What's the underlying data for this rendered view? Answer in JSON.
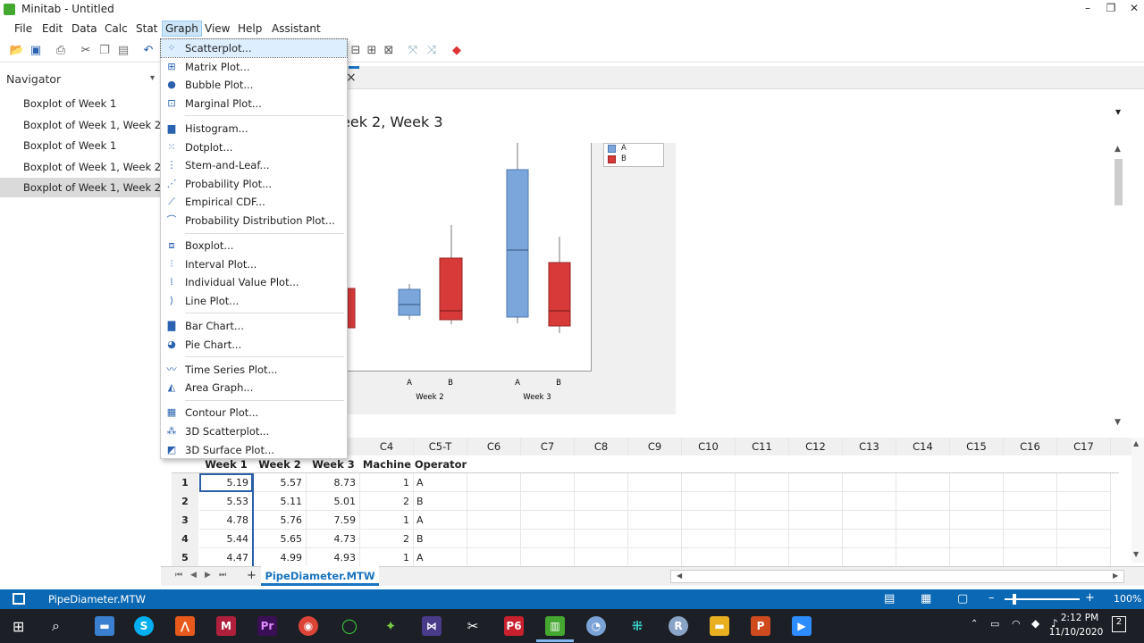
{
  "window": {
    "title": "Minitab - Untitled",
    "minimize": "–",
    "maximize": "❐",
    "close": "✕"
  },
  "menubar": [
    "File",
    "Edit",
    "Data",
    "Calc",
    "Stat",
    "Graph",
    "View",
    "Help",
    "Assistant"
  ],
  "navigator": {
    "header": "Navigator",
    "items": [
      "Boxplot of Week 1",
      "Boxplot of Week 1, Week 2, ...",
      "Boxplot of Week 1",
      "Boxplot of Week 1, Week 2, ...",
      "Boxplot of Week 1, Week 2, ..."
    ],
    "selected_index": 4
  },
  "output": {
    "close_glyph": "×",
    "graph_title_partial": "eek 2, Week 3",
    "dropdown_glyph": "▾"
  },
  "chart_data": {
    "type": "boxplot",
    "legend": [
      {
        "name": "A",
        "color": "#7aa6dc"
      },
      {
        "name": "B",
        "color": "#d83a3a"
      }
    ],
    "groups": [
      {
        "name": "Week 2",
        "categories": [
          "A",
          "B"
        ]
      },
      {
        "name": "Week 3",
        "categories": [
          "A",
          "B"
        ]
      }
    ],
    "colors": {
      "A": "#7aa6dc",
      "B": "#d83a3a"
    }
  },
  "graph_menu": {
    "items": [
      {
        "label": "Scatterplot...",
        "icon": "scatter-icon",
        "glyph": "⁘",
        "highlighted": true
      },
      {
        "label": "Matrix Plot...",
        "icon": "matrix-plot-icon",
        "glyph": "⊞"
      },
      {
        "label": "Bubble Plot...",
        "icon": "bubble-plot-icon",
        "glyph": "●"
      },
      {
        "label": "Marginal Plot...",
        "icon": "marginal-plot-icon",
        "glyph": "⊡"
      },
      {
        "sep": true
      },
      {
        "label": "Histogram...",
        "icon": "histogram-icon",
        "glyph": "▆"
      },
      {
        "label": "Dotplot...",
        "icon": "dotplot-icon",
        "glyph": "⁙"
      },
      {
        "label": "Stem-and-Leaf...",
        "icon": "stem-leaf-icon",
        "glyph": "⋮"
      },
      {
        "label": "Probability Plot...",
        "icon": "probability-plot-icon",
        "glyph": "⋰"
      },
      {
        "label": "Empirical CDF...",
        "icon": "empirical-cdf-icon",
        "glyph": "⟋"
      },
      {
        "label": "Probability Distribution Plot...",
        "icon": "distribution-plot-icon",
        "glyph": "⌒"
      },
      {
        "sep": true
      },
      {
        "label": "Boxplot...",
        "icon": "boxplot-icon",
        "glyph": "⧈"
      },
      {
        "label": "Interval Plot...",
        "icon": "interval-plot-icon",
        "glyph": "⫶"
      },
      {
        "label": "Individual Value Plot...",
        "icon": "individual-value-icon",
        "glyph": "⁞"
      },
      {
        "label": "Line Plot...",
        "icon": "line-plot-icon",
        "glyph": "⟩"
      },
      {
        "sep": true
      },
      {
        "label": "Bar Chart...",
        "icon": "bar-chart-icon",
        "glyph": "▇"
      },
      {
        "label": "Pie Chart...",
        "icon": "pie-chart-icon",
        "glyph": "◕"
      },
      {
        "sep": true
      },
      {
        "label": "Time Series Plot...",
        "icon": "time-series-icon",
        "glyph": "〰"
      },
      {
        "label": "Area Graph...",
        "icon": "area-graph-icon",
        "glyph": "◭"
      },
      {
        "sep": true
      },
      {
        "label": "Contour Plot...",
        "icon": "contour-plot-icon",
        "glyph": "▦"
      },
      {
        "label": "3D Scatterplot...",
        "icon": "3d-scatter-icon",
        "glyph": "⁂"
      },
      {
        "label": "3D Surface Plot...",
        "icon": "3d-surface-icon",
        "glyph": "◩"
      }
    ]
  },
  "worksheet": {
    "column_ids": [
      "C4",
      "C5-T",
      "C6",
      "C7",
      "C8",
      "C9",
      "C10",
      "C11",
      "C12",
      "C13",
      "C14",
      "C15",
      "C16",
      "C17"
    ],
    "variable_names": [
      "Week 1",
      "Week 2",
      "Week 3",
      "Machine",
      "Operator"
    ],
    "rows": [
      {
        "n": "1",
        "cells": [
          "5.19",
          "5.57",
          "8.73",
          "1",
          "A"
        ]
      },
      {
        "n": "2",
        "cells": [
          "5.53",
          "5.11",
          "5.01",
          "2",
          "B"
        ]
      },
      {
        "n": "3",
        "cells": [
          "4.78",
          "5.76",
          "7.59",
          "1",
          "A"
        ]
      },
      {
        "n": "4",
        "cells": [
          "5.44",
          "5.65",
          "4.73",
          "2",
          "B"
        ]
      },
      {
        "n": "5",
        "cells": [
          "4.47",
          "4.99",
          "4.93",
          "1",
          "A"
        ]
      }
    ],
    "sheet_tab": "PipeDiameter.MTW",
    "add_sheet": "+"
  },
  "status": {
    "file": "PipeDiameter.MTW",
    "zoom": "100%",
    "zoom_minus": "–",
    "zoom_plus": "+"
  },
  "taskbar": {
    "time": "2:12 PM",
    "date": "11/10/2020",
    "notifications": "2"
  }
}
